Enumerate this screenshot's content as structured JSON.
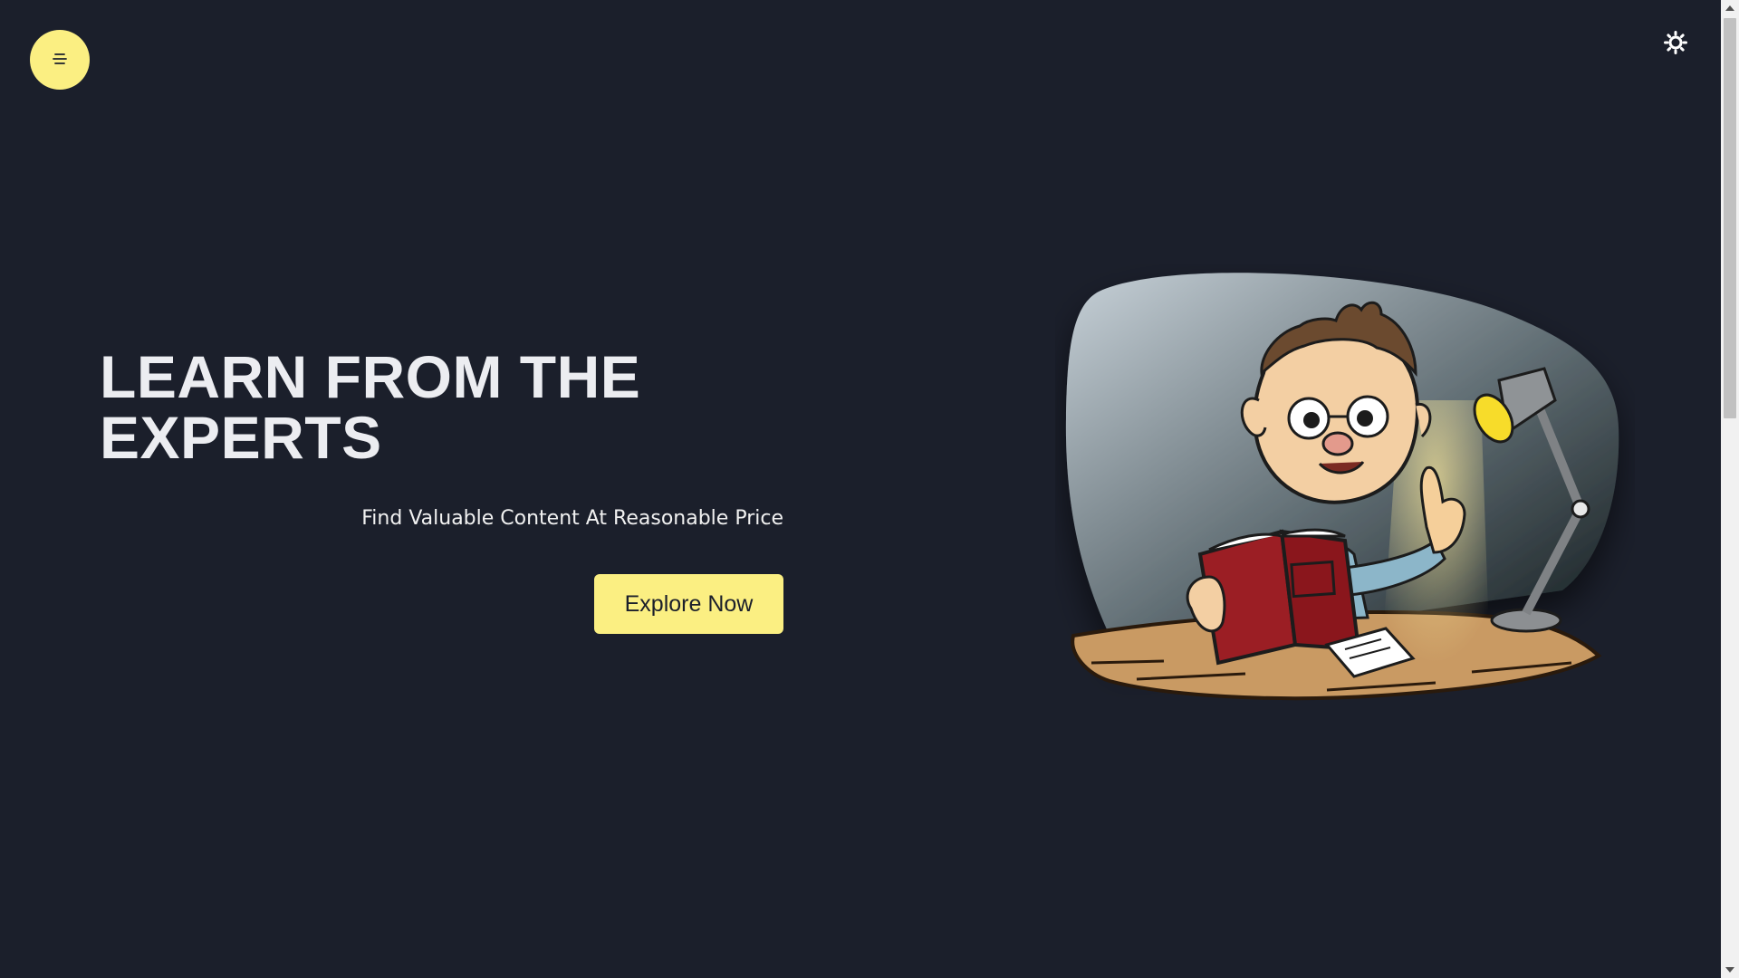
{
  "header": {
    "menu_icon": "menu-icon",
    "theme_icon": "sun-icon"
  },
  "hero": {
    "title_line1": "LEARN FROM THE",
    "title_line2": "EXPERTS",
    "subtitle": "Find Valuable Content At Reasonable Price",
    "cta_label": "Explore Now"
  },
  "colors": {
    "background": "#1b1f2b",
    "accent": "#fbef82",
    "text": "#ecedf1"
  }
}
